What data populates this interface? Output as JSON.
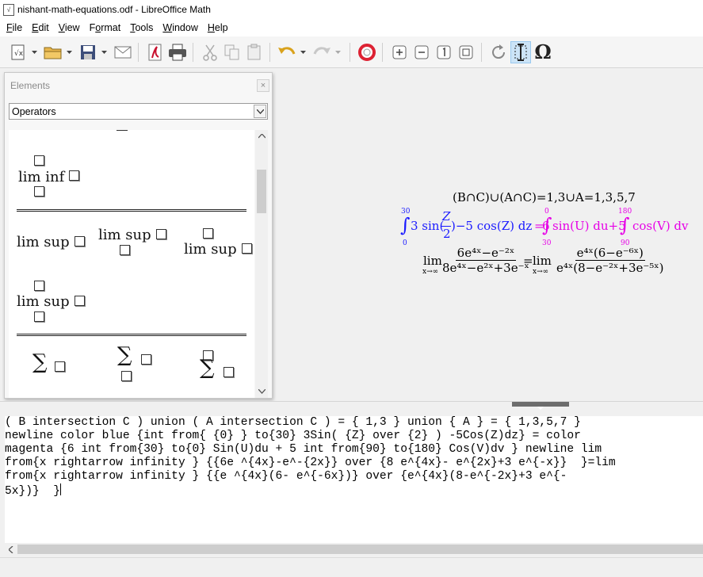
{
  "window": {
    "title": "nishant-math-equations.odf - LibreOffice Math"
  },
  "menu": [
    {
      "label": "File",
      "key": "F"
    },
    {
      "label": "Edit",
      "key": "E"
    },
    {
      "label": "View",
      "key": "V"
    },
    {
      "label": "Format",
      "key": "o"
    },
    {
      "label": "Tools",
      "key": "T"
    },
    {
      "label": "Window",
      "key": "W"
    },
    {
      "label": "Help",
      "key": "H"
    }
  ],
  "toolbar": {
    "icons": [
      "new-formula-icon",
      "open-folder-icon",
      "save-icon",
      "email-icon",
      "export-pdf-icon",
      "print-icon",
      "cut-icon",
      "copy-icon",
      "paste-icon",
      "undo-icon",
      "redo-icon",
      "help-lifebuoy-icon",
      "zoom-in-icon",
      "zoom-out-icon",
      "show-all-icon",
      "zoom-fit-icon",
      "update-icon",
      "formula-cursor-icon",
      "symbols-icon"
    ],
    "omega": "Ω"
  },
  "elements_panel": {
    "title": "Elements",
    "close": "×",
    "category": "Operators",
    "items": {
      "lim_inf": "lim inf",
      "lim_sup": "lim sup",
      "sigma": "∑"
    }
  },
  "formula": {
    "line1": "(B∩C)∪(A∩C)=1,3∪A=1,3,5,7",
    "line2": {
      "int1_upper": "30",
      "int1_lower": "0",
      "blue_body": "3 sin(",
      "z": "Z",
      "two": "2",
      "blue_tail": ")−5 cos(Z) dz",
      "eq": "=",
      "mag_start": "6",
      "int2_upper": "0",
      "int2_lower": "30",
      "mag_mid": "sin(U) du+5",
      "int3_upper": "180",
      "int3_lower": "90",
      "mag_end": "cos(V) dv"
    },
    "line3": {
      "lim": "lim",
      "sub": "x→∞",
      "num1": "6e⁴ˣ−e⁻²ˣ",
      "den1": "8e⁴ˣ−e²ˣ+3e⁻ˣ",
      "eq": "=",
      "num2": "e⁴ˣ(6−e⁻⁶ˣ)",
      "den2": "e⁴ˣ(8−e⁻²ˣ+3e⁻⁵ˣ)"
    }
  },
  "command": {
    "lines": [
      "( B intersection C ) union ( A intersection C ) = { 1,3 } union { A } = { 1,3,5,7 }",
      "newline color blue {int from{ {0} } to{30} 3Sin( {Z} over {2} ) -5Cos(Z)dz} = color",
      "magenta {6 int from{30} to{0} Sin(U)du + 5 int from{90} to{180} Cos(V)dv } newline lim",
      "from{x rightarrow infinity } {{6e ^{4x}-e^-{2x}} over {8 e^{4x}- e^{2x}+3 e^{-x}}  }=lim",
      "from{x rightarrow infinity } {{e ^{4x}(6- e^{-6x})} over {e^{4x}(8-e^{-2x}+3 e^{-",
      "5x})}  }"
    ]
  },
  "colors": {
    "blue": "#1a1aff",
    "magenta": "#e600e6",
    "highlight": "#cce4f7"
  }
}
